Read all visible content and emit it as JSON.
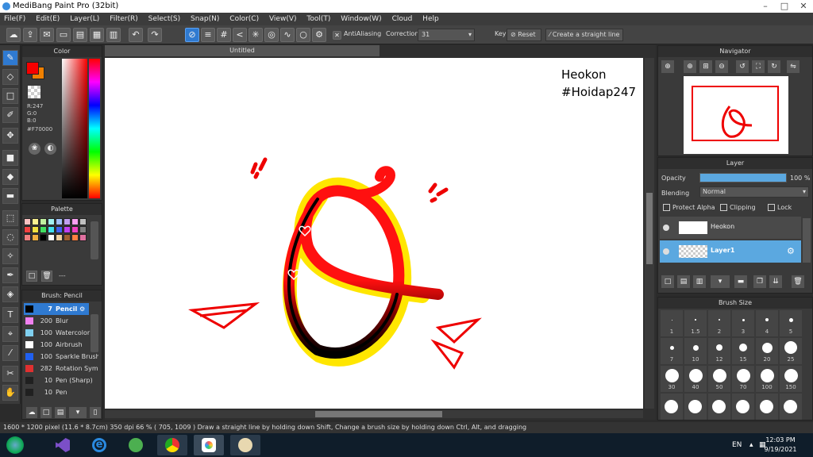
{
  "titlebar": {
    "title": "MediBang Paint Pro (32bit)"
  },
  "menu": [
    "File(F)",
    "Edit(E)",
    "Layer(L)",
    "Filter(R)",
    "Select(S)",
    "Snap(N)",
    "Color(C)",
    "View(V)",
    "Tool(T)",
    "Window(W)",
    "Cloud",
    "Help"
  ],
  "toolbar": {
    "antialiasing_label": "AntiAliasing",
    "correction_label": "Correction",
    "correction_value": "31",
    "key_label": "Key",
    "reset_label": "Reset",
    "straight_line_label": "Create a straight line"
  },
  "color_panel": {
    "title": "Color",
    "r": "R:247",
    "g": "G:0",
    "b": "B:0",
    "hex": "#F70000",
    "primary_color": "#F70000",
    "secondary_color": "#F08000"
  },
  "palette_panel": {
    "title": "Palette",
    "footer": "---",
    "swatches": [
      "#f9c0c0",
      "#f9f090",
      "#c0f0a0",
      "#a0f0f0",
      "#a0c0f9",
      "#c0a0f0",
      "#f9a0f0",
      "#c0c0c0",
      "#f04040",
      "#f0e040",
      "#40e060",
      "#40e0f0",
      "#4060f0",
      "#c040f0",
      "#f040c0",
      "#808080",
      "#f08080",
      "#f0b040",
      "#000000",
      "#ffffff",
      "#f0d0a0",
      "#a06030",
      "#ff8040",
      "#e070a0"
    ]
  },
  "brush_panel": {
    "title": "Brush: Pencil",
    "items": [
      {
        "size": "7",
        "name": "Pencil",
        "color": "#000000"
      },
      {
        "size": "200",
        "name": "Blur",
        "color": "#f080f0"
      },
      {
        "size": "100",
        "name": "Watercolor",
        "color": "#80d0f0"
      },
      {
        "size": "100",
        "name": "Airbrush",
        "color": "#ffffff"
      },
      {
        "size": "100",
        "name": "Sparkle Brush",
        "color": "#2060f0"
      },
      {
        "size": "282",
        "name": "Rotation Symmetry",
        "color": "#e03030"
      },
      {
        "size": "10",
        "name": "Pen (Sharp)",
        "color": "#202020"
      },
      {
        "size": "10",
        "name": "Pen",
        "color": "#202020"
      }
    ]
  },
  "document": {
    "tab_title": "Untitled"
  },
  "canvas_text": {
    "line1": "Heokon",
    "line2": "#Hoidap247"
  },
  "navigator": {
    "title": "Navigator"
  },
  "layer_panel": {
    "title": "Layer",
    "opacity_label": "Opacity",
    "opacity_value": "100 %",
    "opacity_fraction": 1.0,
    "blending_label": "Blending",
    "blending_value": "Normal",
    "protect_alpha": "Protect Alpha",
    "clipping": "Clipping",
    "lock": "Lock",
    "layers": [
      {
        "name": "Heokon",
        "selected": false
      },
      {
        "name": "Layer1",
        "selected": true
      }
    ]
  },
  "brush_size_panel": {
    "title": "Brush Size",
    "sizes": [
      "1",
      "1.5",
      "2",
      "3",
      "4",
      "5",
      "7",
      "10",
      "12",
      "15",
      "20",
      "25",
      "30",
      "40",
      "50",
      "70",
      "100",
      "150"
    ]
  },
  "statusbar": {
    "text": "1600 * 1200 pixel  (11.6 * 8.7cm)  350 dpi  66 %  ( 705, 1009 )  Draw a straight line by holding down Shift, Change a brush size by holding down Ctrl, Alt, and dragging"
  },
  "taskbar": {
    "lang": "EN",
    "time": "12:03 PM",
    "date": "9/19/2021"
  }
}
